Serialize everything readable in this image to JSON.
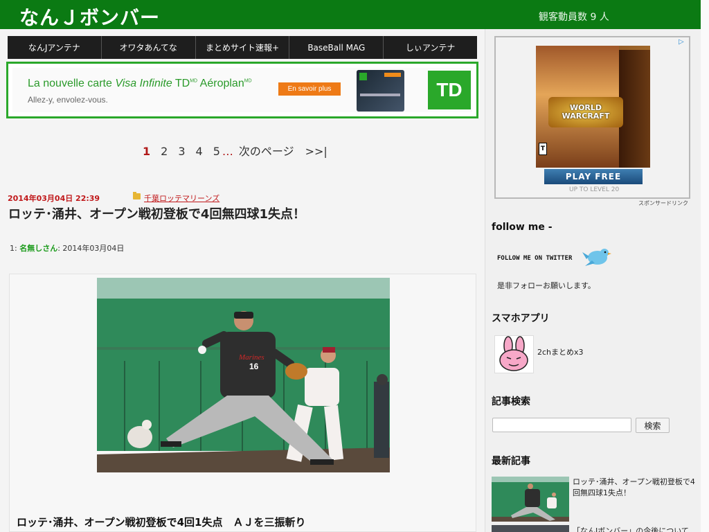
{
  "header": {
    "site_title": "なんＪボンバー",
    "visitor_count": "観客動員数 9 人"
  },
  "nav": {
    "items": [
      {
        "label": "なんJアンテナ"
      },
      {
        "label": "オワタあんてな"
      },
      {
        "label": "まとめサイト速報+"
      },
      {
        "label": "BaseBall MAG"
      },
      {
        "label": "しぃアンテナ"
      }
    ]
  },
  "banner_ad": {
    "title_pre": "La nouvelle carte ",
    "title_italic": "Visa Infinite",
    "title_td": " TD",
    "title_sup1": "MD",
    "title_post": " Aéroplan",
    "title_sup2": "MD",
    "subtitle": "Allez-y, envolez-vous.",
    "button_label": "En savoir plus",
    "brand": "TD"
  },
  "pagination": {
    "pages": [
      "1",
      "2",
      "3",
      "4",
      "5"
    ],
    "current": "1",
    "ellipsis": "…",
    "next_label": "次のページ",
    "last_label": ">>|"
  },
  "article": {
    "date": "2014年03月04日 22:39",
    "category": "千葉ロッテマリーンズ",
    "title": "ロッテ･涌井、オープン戦初登板で4回無四球1失点！",
    "post_number": "1:",
    "post_name": "名無しさん",
    "post_date": ": 2014年03月04日",
    "body_headline": "ロッテ･涌井、オープン戦初登板で4回1失点　ＡＪを三振斬り"
  },
  "sidebar": {
    "ad": {
      "logo_line1": "WORLD",
      "logo_line2": "WARCRAFT",
      "rating": "T",
      "button": "PLAY FREE",
      "caption": "UP TO LEVEL 20",
      "sponsor": "スポンサードリンク",
      "adchoice": "▷"
    },
    "follow_heading": "follow me -",
    "follow_twitter": "FOLLOW ME ON TWITTER",
    "follow_note": "是非フォローお願いします。",
    "app_heading": "スマホアプリ",
    "app_name": "2chまとめx3",
    "search_heading": "記事検索",
    "search_value": "",
    "search_button": "検索",
    "recent_heading": "最新記事",
    "recent_items": [
      {
        "title": "ロッテ･涌井、オープン戦初登板で4回無四球1失点！"
      },
      {
        "title": "「なんJボンバー」の今後について"
      }
    ]
  }
}
